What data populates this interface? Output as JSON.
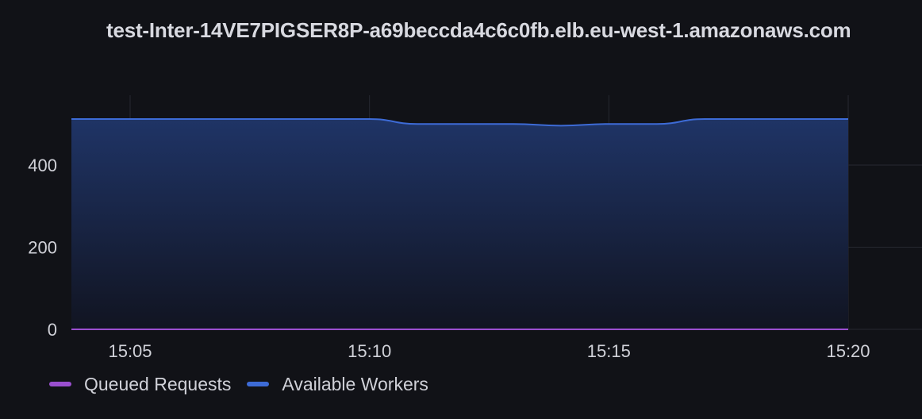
{
  "panel": {
    "title": "test-Inter-14VE7PIGSER8P-a69beccda4c6c0fb.elb.eu-west-1.amazonaws.com"
  },
  "chart_data": {
    "type": "area",
    "title": "test-Inter-14VE7PIGSER8P-a69beccda4c6c0fb.elb.eu-west-1.amazonaws.com",
    "xlabel": "",
    "ylabel": "",
    "x_range": [
      "15:03:30",
      "15:23:00"
    ],
    "ylim": [
      0,
      570
    ],
    "y_ticks": [
      0,
      200,
      400
    ],
    "y_tick_labels": [
      "0",
      "200",
      "400"
    ],
    "x_ticks": [
      "15:05",
      "15:10",
      "15:15",
      "15:20"
    ],
    "grid": true,
    "legend_position": "bottom-left",
    "series": [
      {
        "name": "Queued Requests",
        "color": "#9b4fd0",
        "fill": false,
        "points": [
          [
            "15:03:30",
            0
          ],
          [
            "15:05",
            0
          ],
          [
            "15:10",
            0
          ],
          [
            "15:15",
            0
          ],
          [
            "15:20",
            0
          ]
        ]
      },
      {
        "name": "Available Workers",
        "color": "#3d6bd6",
        "fill": true,
        "points": [
          [
            "15:03:30",
            512
          ],
          [
            "15:05",
            512
          ],
          [
            "15:10",
            512
          ],
          [
            "15:11",
            500
          ],
          [
            "15:12",
            500
          ],
          [
            "15:13",
            500
          ],
          [
            "15:14",
            496
          ],
          [
            "15:15",
            500
          ],
          [
            "15:16",
            500
          ],
          [
            "15:17",
            512
          ],
          [
            "15:18",
            512
          ],
          [
            "15:19",
            512
          ],
          [
            "15:20",
            512
          ]
        ]
      }
    ]
  }
}
